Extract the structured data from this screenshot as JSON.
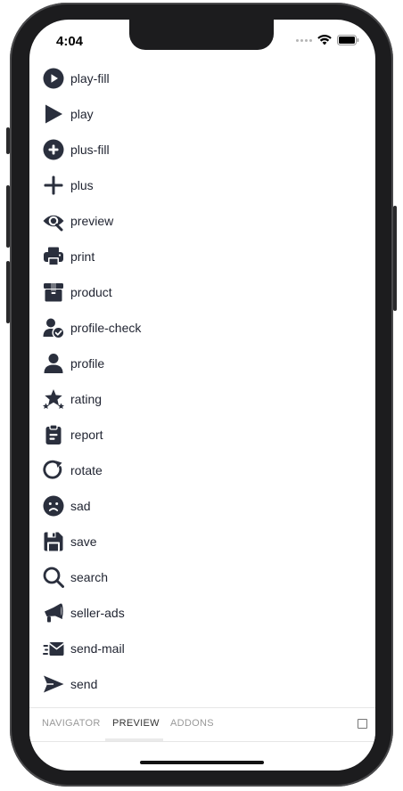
{
  "status": {
    "time": "4:04"
  },
  "icons": [
    {
      "name": "play-fill",
      "icon": "play-fill-icon"
    },
    {
      "name": "play",
      "icon": "play-icon"
    },
    {
      "name": "plus-fill",
      "icon": "plus-fill-icon"
    },
    {
      "name": "plus",
      "icon": "plus-icon"
    },
    {
      "name": "preview",
      "icon": "preview-icon"
    },
    {
      "name": "print",
      "icon": "print-icon"
    },
    {
      "name": "product",
      "icon": "product-icon"
    },
    {
      "name": "profile-check",
      "icon": "profile-check-icon"
    },
    {
      "name": "profile",
      "icon": "profile-icon"
    },
    {
      "name": "rating",
      "icon": "rating-icon"
    },
    {
      "name": "report",
      "icon": "report-icon"
    },
    {
      "name": "rotate",
      "icon": "rotate-icon"
    },
    {
      "name": "sad",
      "icon": "sad-icon"
    },
    {
      "name": "save",
      "icon": "save-icon"
    },
    {
      "name": "search",
      "icon": "search-icon"
    },
    {
      "name": "seller-ads",
      "icon": "seller-ads-icon"
    },
    {
      "name": "send-mail",
      "icon": "send-mail-icon"
    },
    {
      "name": "send",
      "icon": "send-icon"
    }
  ],
  "tabs": [
    {
      "label": "NAVIGATOR",
      "active": false
    },
    {
      "label": "PREVIEW",
      "active": true
    },
    {
      "label": "ADDONS",
      "active": false
    }
  ],
  "colors": {
    "icon": "#2a2f3d",
    "text": "#1f2330",
    "tab_inactive": "#999999",
    "tab_active": "#333333"
  }
}
